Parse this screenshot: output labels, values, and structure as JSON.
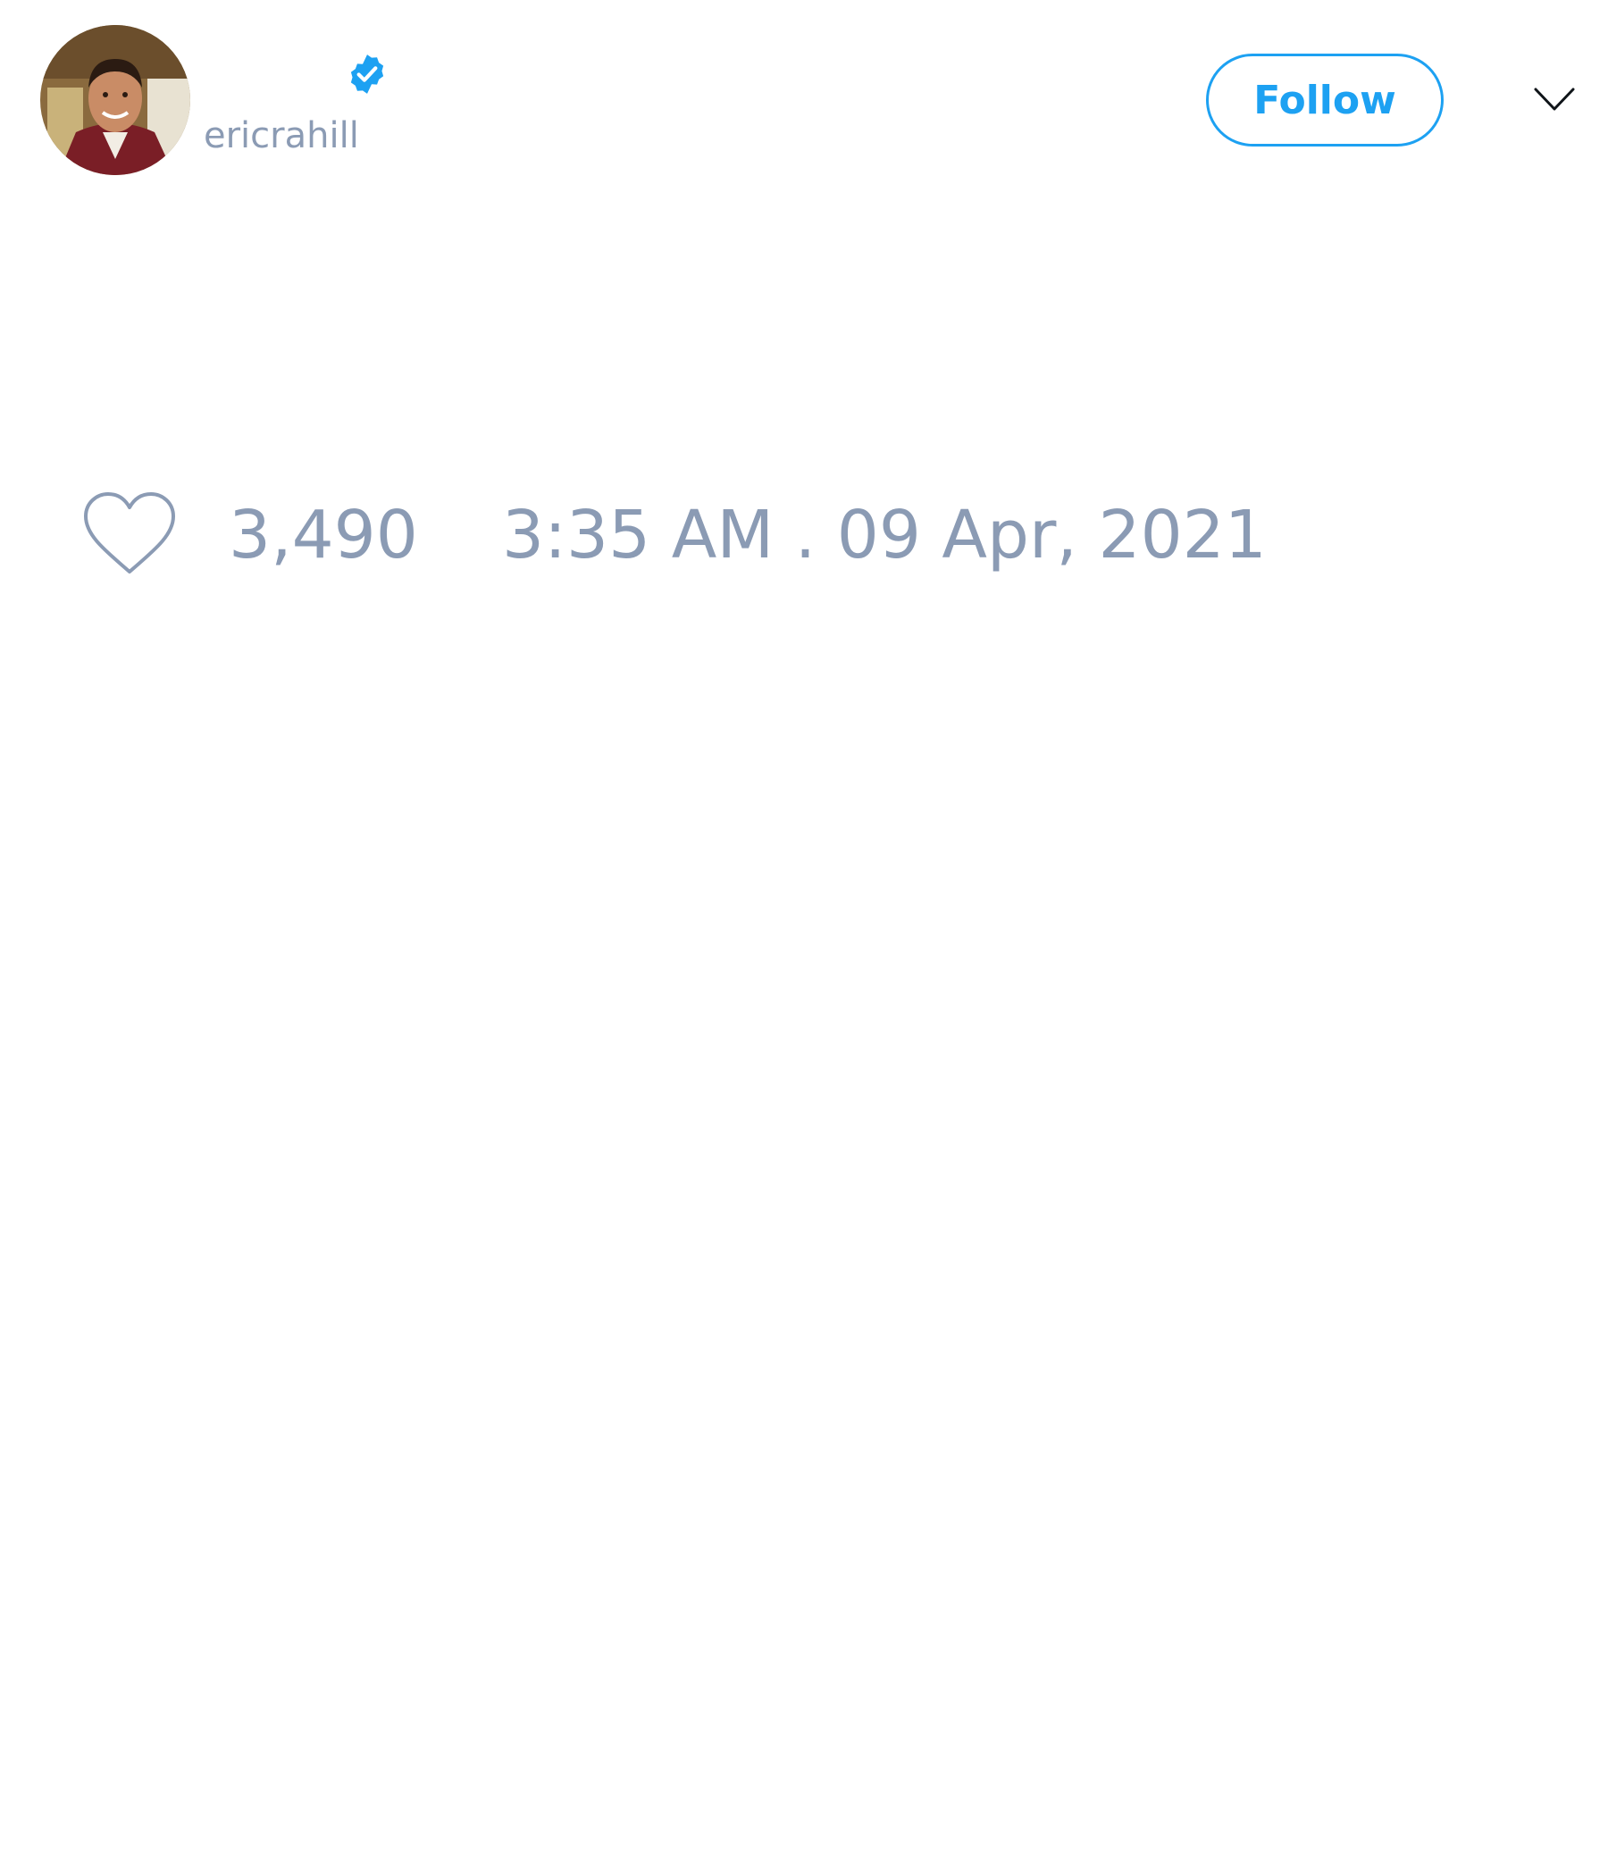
{
  "author": {
    "display_name": "",
    "handle": "ericrahill",
    "verified": true,
    "avatar_icon": "user-avatar-photo"
  },
  "actions": {
    "follow_label": "Follow",
    "menu_icon": "chevron-down-icon"
  },
  "stats": {
    "like_icon": "heart-icon",
    "like_count": "3,490",
    "timestamp": "3:35 AM . 09 Apr, 2021"
  },
  "colors": {
    "accent": "#1da1f2",
    "muted_text": "#8b9bb4",
    "background": "#ffffff"
  }
}
